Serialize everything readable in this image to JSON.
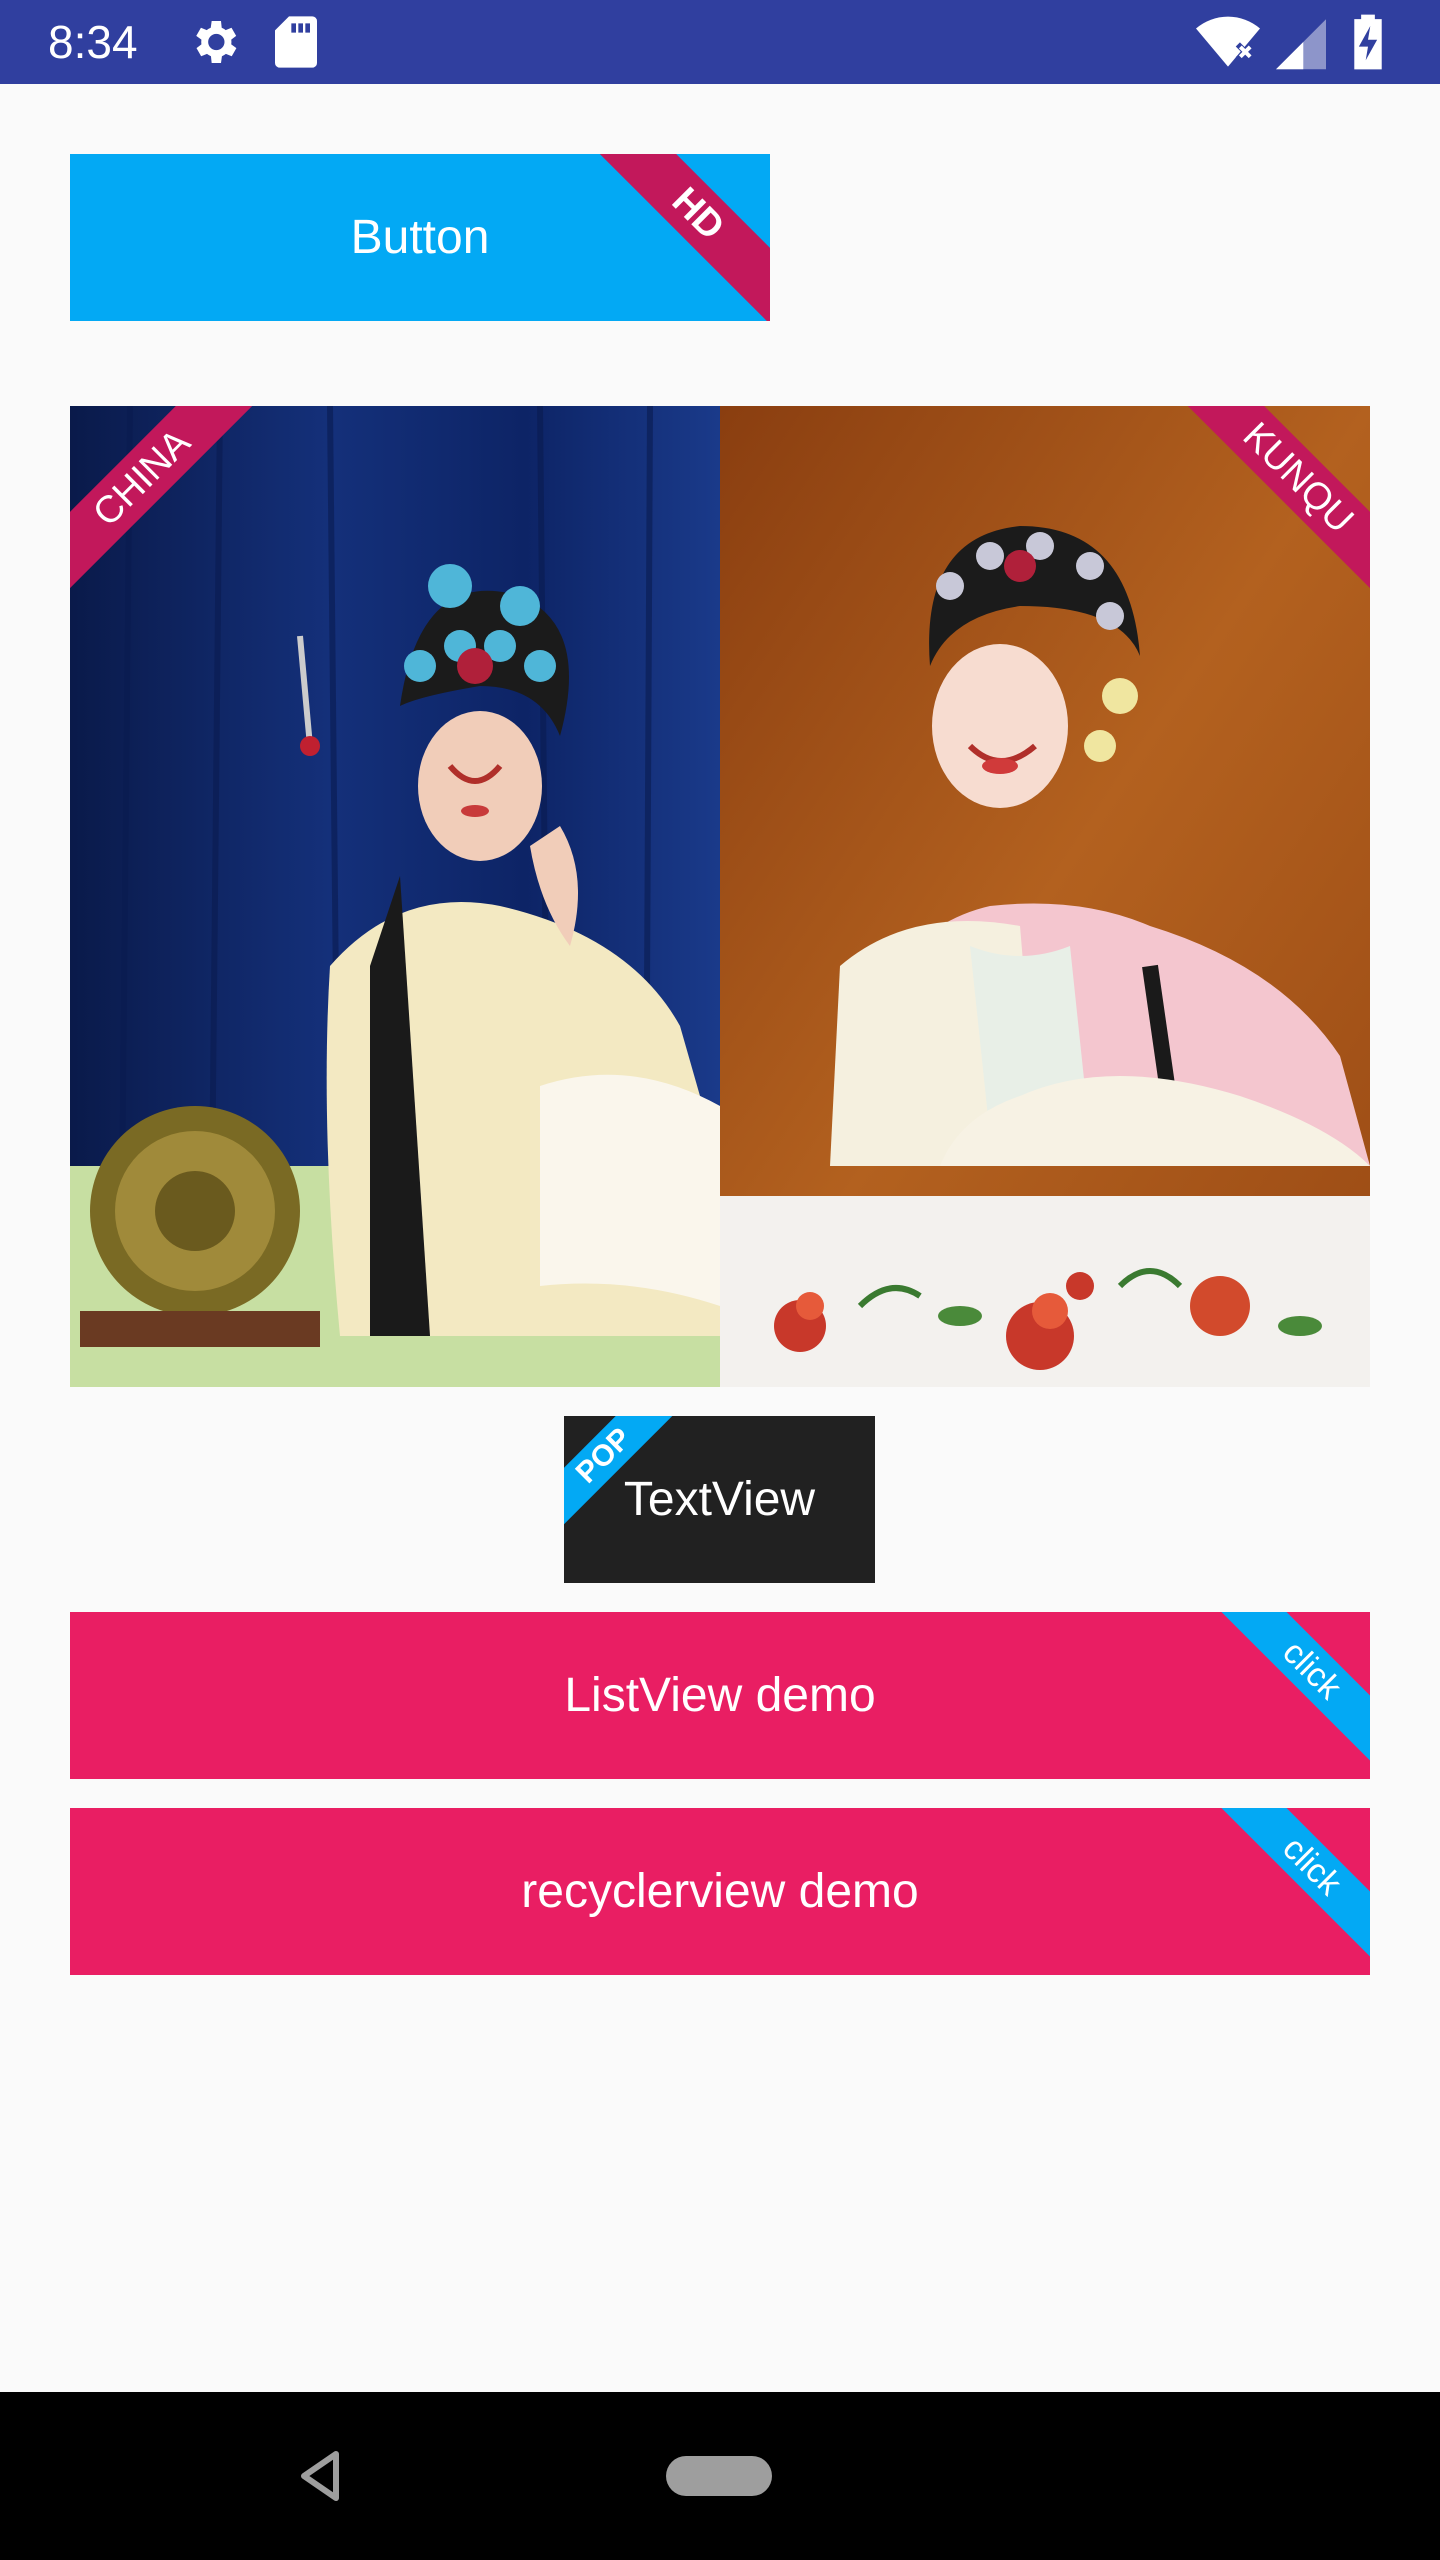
{
  "status_bar": {
    "time": "8:34",
    "icons": [
      "settings-icon",
      "sd-card-icon",
      "wifi-icon",
      "signal-icon",
      "battery-charging-icon"
    ],
    "background": "#303f9f"
  },
  "button": {
    "label": "Button",
    "ribbon": "HD",
    "color": "#03a9f4",
    "ribbon_color": "#c2185b"
  },
  "photos": {
    "left": {
      "ribbon": "CHINA",
      "ribbon_color": "#c2185b"
    },
    "right": {
      "ribbon": "KUNQU",
      "ribbon_color": "#c2185b"
    }
  },
  "textview": {
    "label": "TextView",
    "ribbon": "POP",
    "color": "#212121",
    "ribbon_color": "#03a9f4"
  },
  "listview_button": {
    "label": "ListView demo",
    "ribbon": "click",
    "color": "#e91e63",
    "ribbon_color": "#03a9f4"
  },
  "recyclerview_button": {
    "label": "recyclerview demo",
    "ribbon": "click",
    "color": "#e91e63",
    "ribbon_color": "#03a9f4"
  },
  "nav_bar": {
    "icons": [
      "back-icon",
      "home-pill-icon"
    ]
  }
}
